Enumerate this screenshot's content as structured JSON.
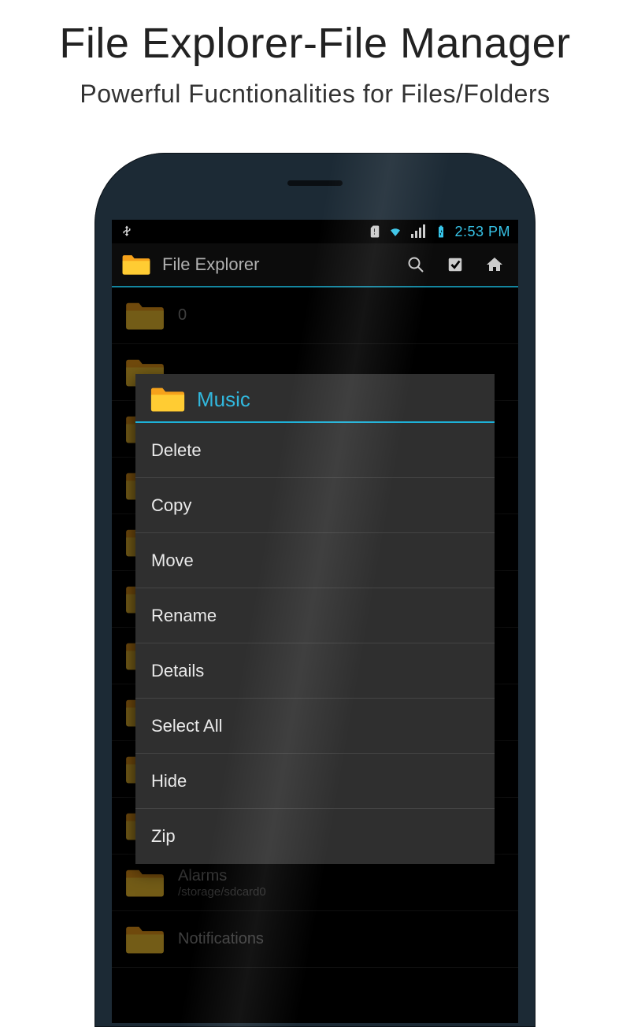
{
  "promo": {
    "title": "File Explorer-File Manager",
    "subtitle": "Powerful Fucntionalities for Files/Folders"
  },
  "statusbar": {
    "clock": "2:53 PM"
  },
  "toolbar": {
    "title": "File Explorer"
  },
  "filelist": [
    {
      "name": "0",
      "path": ""
    },
    {
      "name": "",
      "path": ""
    },
    {
      "name": "",
      "path": ""
    },
    {
      "name": "",
      "path": ""
    },
    {
      "name": "",
      "path": ""
    },
    {
      "name": "",
      "path": ""
    },
    {
      "name": "",
      "path": ""
    },
    {
      "name": "",
      "path": ""
    },
    {
      "name": "",
      "path": ""
    },
    {
      "name": "",
      "path": ""
    },
    {
      "name": "Alarms",
      "path": "/storage/sdcard0"
    },
    {
      "name": "Notifications",
      "path": ""
    }
  ],
  "dialog": {
    "title": "Music",
    "items": [
      "Delete",
      "Copy",
      "Move",
      "Rename",
      "Details",
      "Select All",
      "Hide",
      "Zip"
    ]
  }
}
